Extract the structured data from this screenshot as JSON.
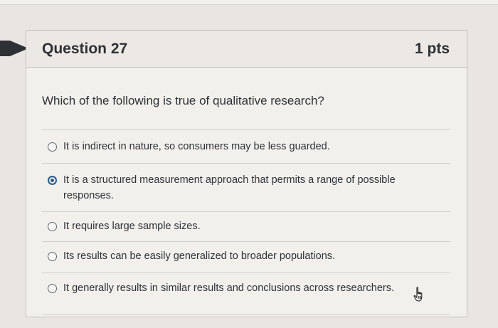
{
  "question": {
    "title": "Question 27",
    "points": "1 pts",
    "prompt": "Which of the following is true of qualitative research?"
  },
  "answers": [
    {
      "label": "It is indirect in nature, so consumers may be less guarded.",
      "selected": false
    },
    {
      "label": "It is a structured measurement approach that permits a range of possible responses.",
      "selected": true
    },
    {
      "label": "It requires large sample sizes.",
      "selected": false
    },
    {
      "label": "Its results can be easily generalized to broader populations.",
      "selected": false
    },
    {
      "label": "It generally results in similar results and conclusions across researchers.",
      "selected": false
    }
  ],
  "colors": {
    "selected_radio": "#2b5e8f",
    "text": "#2d3136",
    "marker": "#2d3136"
  },
  "icons": {
    "cursor": "hand-pointer-icon",
    "marker": "current-question-marker-icon"
  }
}
